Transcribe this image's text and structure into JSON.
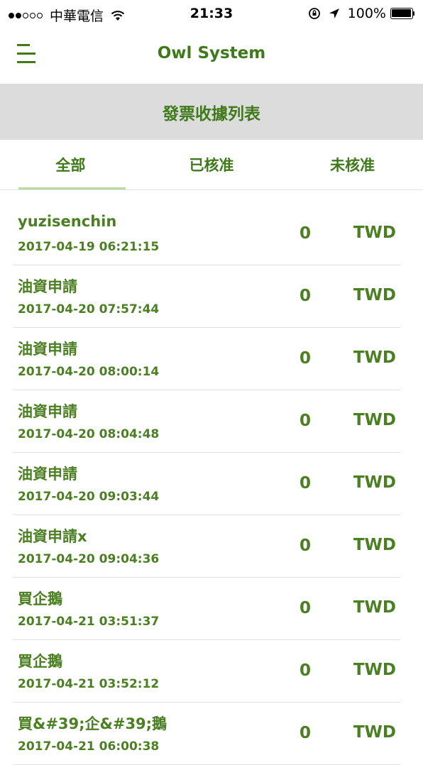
{
  "status_bar": {
    "carrier": "中華電信",
    "time": "21:33",
    "battery": "100%",
    "signal_bars_filled": 2,
    "signal_bars_total": 5
  },
  "nav": {
    "title": "Owl System",
    "menu_icon": "hamburger-menu-icon"
  },
  "section": {
    "title": "發票收據列表"
  },
  "tabs": [
    {
      "label": "全部",
      "active": true
    },
    {
      "label": "已核准",
      "active": false
    },
    {
      "label": "未核准",
      "active": false
    }
  ],
  "records": [
    {
      "name": "yuzisenchin",
      "datetime": "2017-04-19 06:21:15",
      "amount": "0",
      "currency": "TWD"
    },
    {
      "name": "油資申請",
      "datetime": "2017-04-20 07:57:44",
      "amount": "0",
      "currency": "TWD"
    },
    {
      "name": "油資申請",
      "datetime": "2017-04-20 08:00:14",
      "amount": "0",
      "currency": "TWD"
    },
    {
      "name": "油資申請",
      "datetime": "2017-04-20 08:04:48",
      "amount": "0",
      "currency": "TWD"
    },
    {
      "name": "油資申請",
      "datetime": "2017-04-20 09:03:44",
      "amount": "0",
      "currency": "TWD"
    },
    {
      "name": "油資申請x",
      "datetime": "2017-04-20 09:04:36",
      "amount": "0",
      "currency": "TWD"
    },
    {
      "name": "買企鵝",
      "datetime": "2017-04-21 03:51:37",
      "amount": "0",
      "currency": "TWD"
    },
    {
      "name": "買企鵝",
      "datetime": "2017-04-21 03:52:12",
      "amount": "0",
      "currency": "TWD"
    },
    {
      "name": "買&#39;企&#39;鵝",
      "datetime": "2017-04-21 06:00:38",
      "amount": "0",
      "currency": "TWD"
    }
  ],
  "colors": {
    "accent_green": "#3f7a1a",
    "row_text_green": "#4a7f22",
    "header_band": "#dcdcdc",
    "tab_indicator": "#b8dca4",
    "divider": "#e2e2e2"
  }
}
